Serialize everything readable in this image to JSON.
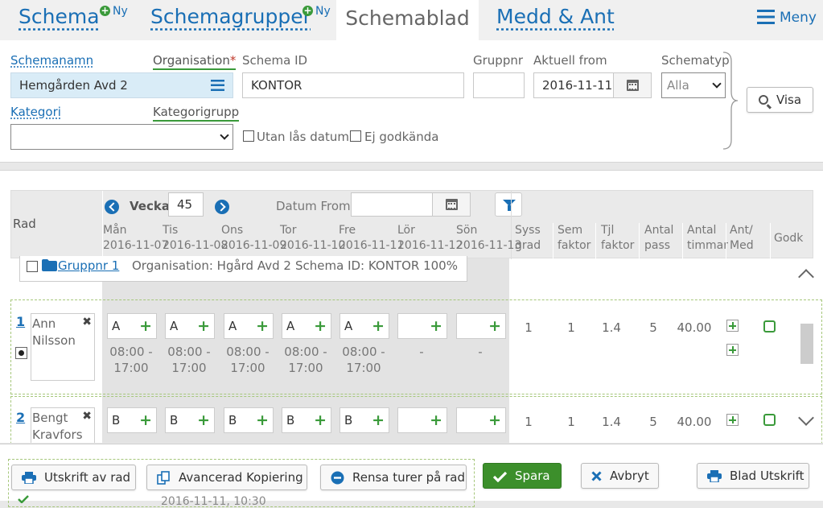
{
  "tabs": {
    "schema": "Schema",
    "schema_new": "Ny",
    "schemagrupper": "Schemagrupper",
    "schemagrupper_new": "Ny",
    "schemablad": "Schemablad",
    "medd": "Medd & Ant",
    "menu": "Meny"
  },
  "filter": {
    "schemanamn_label": "Schemanamn",
    "organisation_label": "Organisation",
    "required_mark": "*",
    "schemanamn_value": "Hemgården Avd 2",
    "schema_id_label": "Schema ID",
    "schema_id_value": "KONTOR",
    "gruppnr_label": "Gruppnr",
    "gruppnr_value": "",
    "aktuell_from_label": "Aktuell from",
    "aktuell_from_value": "2016-11-11",
    "schematyp_label": "Schematyp",
    "schematyp_value": "Alla",
    "kategori_label": "Kategori",
    "kategorigrupp_label": "Kategorigrupp",
    "kategori_value": "",
    "utan_las_label": "Utan lås datum",
    "ej_godkanda_label": "Ej godkända",
    "visa_label": "Visa"
  },
  "grid": {
    "rad_label": "Rad",
    "vecka_label": "Vecka",
    "vecka_value": "45",
    "datum_from_label": "Datum From",
    "datum_from_value": "",
    "days": [
      {
        "name": "Mån",
        "date": "2016-11-07"
      },
      {
        "name": "Tis",
        "date": "2016-11-08"
      },
      {
        "name": "Ons",
        "date": "2016-11-09"
      },
      {
        "name": "Tor",
        "date": "2016-11-10"
      },
      {
        "name": "Fre",
        "date": "2016-11-11"
      },
      {
        "name": "Lör",
        "date": "2016-11-12"
      },
      {
        "name": "Sön",
        "date": "2016-11-13"
      }
    ],
    "columns": {
      "syss": [
        "Syss",
        "grad"
      ],
      "sem": [
        "Sem",
        "faktor"
      ],
      "tjl": [
        "Tjl",
        "faktor"
      ],
      "antal_pass": [
        "Antal",
        "pass"
      ],
      "antal_timmar": [
        "Antal",
        "timmar"
      ],
      "ant_med": [
        "Ant/",
        "Med"
      ],
      "godk": "Godk"
    },
    "group": {
      "link": "Gruppnr 1",
      "org": "Organisation: Hgård Avd 2",
      "schema": "Schema ID: KONTOR 100%"
    },
    "rows": [
      {
        "num": "1",
        "name": "Ann Nilsson",
        "cells": [
          "A",
          "A",
          "A",
          "A",
          "A",
          "",
          ""
        ],
        "times": [
          [
            "08:00 -",
            "17:00"
          ],
          [
            "08:00 -",
            "17:00"
          ],
          [
            "08:00 -",
            "17:00"
          ],
          [
            "08:00 -",
            "17:00"
          ],
          [
            "08:00 -",
            "17:00"
          ],
          [
            "-",
            ""
          ],
          [
            "-",
            ""
          ]
        ],
        "syss": "1",
        "sem": "1",
        "tjl": "1.4",
        "pass": "5",
        "timmar": "40.00"
      },
      {
        "num": "2",
        "name": "Bengt Kravfors",
        "cells": [
          "B",
          "B",
          "B",
          "B",
          "B",
          "",
          ""
        ],
        "syss": "1",
        "sem": "1",
        "tjl": "1.4",
        "pass": "5",
        "timmar": "40.00"
      }
    ]
  },
  "bottom": {
    "utskrift_rad": "Utskrift av rad",
    "avancerad_kopiering": "Avancerad Kopiering",
    "rensa_turer": "Rensa turer på rad",
    "spara": "Spara",
    "avbryt": "Avbryt",
    "blad_utskrift": "Blad Utskrift",
    "status_fragment": "2016-11-11, 10:30"
  },
  "colors": {
    "accent_blue": "#1a6fb5",
    "green": "#3a9a3a",
    "save_green": "#3c8f2b",
    "danger_red": "#c0392b"
  }
}
